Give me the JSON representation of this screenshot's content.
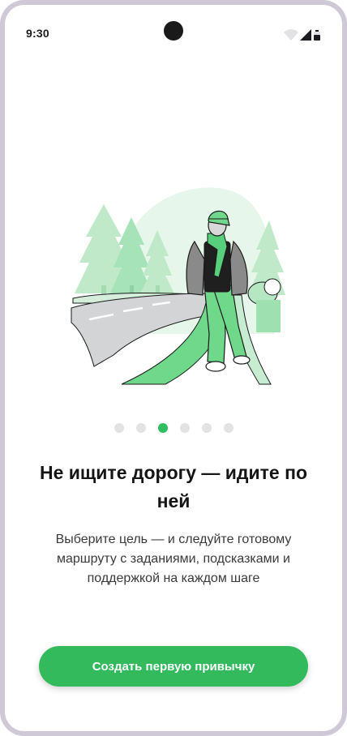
{
  "status_bar": {
    "time": "9:30",
    "icons": [
      "wifi-icon",
      "signal-icon",
      "battery-icon"
    ]
  },
  "onboarding": {
    "illustration": "man-walking-on-road-illustration",
    "pagination": {
      "total": 6,
      "active_index": 2
    },
    "title": "Не ищите дорогу — идите по ней",
    "subtitle": "Выберите цель — и следуйте готовому маршруту с заданиями, подсказками и поддержкой на каждом шаге",
    "cta_label": "Создать первую привычку"
  },
  "colors": {
    "accent": "#32ba5c",
    "dot_inactive": "#e3e3e6",
    "text_primary": "#151515",
    "text_secondary": "#3a3a3a",
    "frame": "#cfc8d6"
  }
}
